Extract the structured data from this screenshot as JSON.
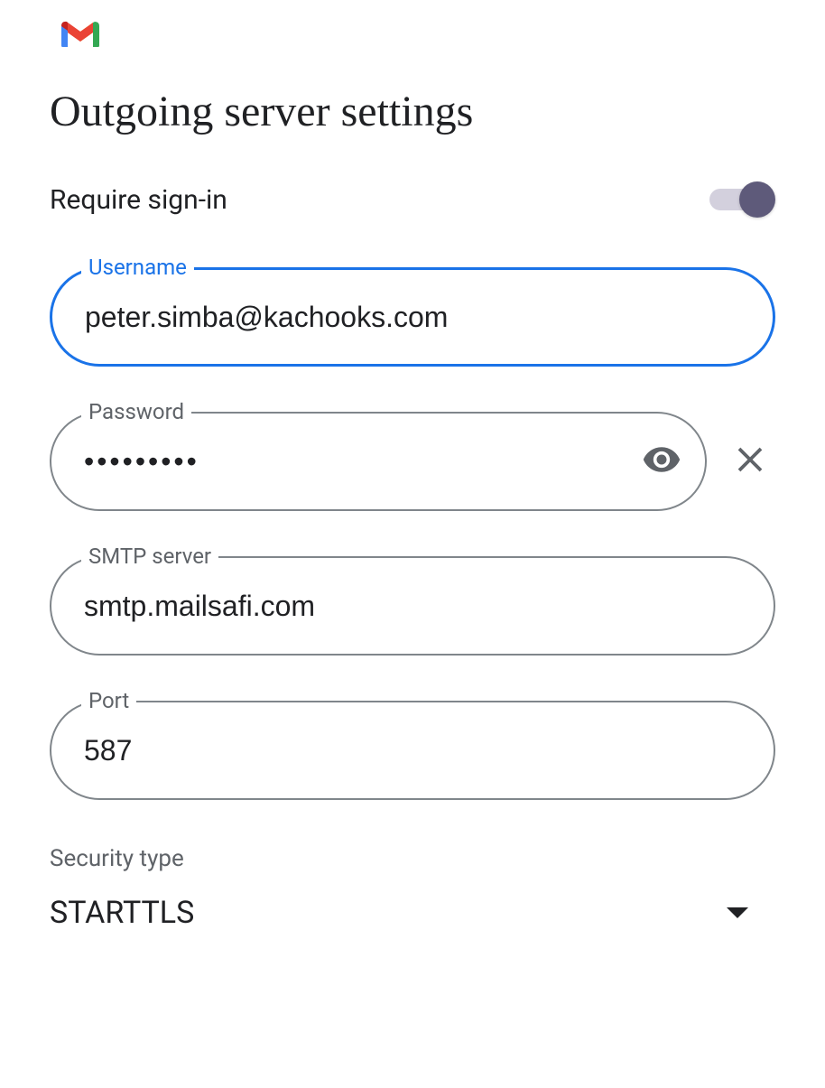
{
  "logo": "gmail",
  "title": "Outgoing server settings",
  "toggle": {
    "label": "Require sign-in",
    "state": "on"
  },
  "fields": {
    "username": {
      "label": "Username",
      "value": "peter.simba@kachooks.com"
    },
    "password": {
      "label": "Password",
      "value": "•••••••••"
    },
    "smtp": {
      "label": "SMTP server",
      "value": "smtp.mailsafi.com"
    },
    "port": {
      "label": "Port",
      "value": "587"
    }
  },
  "security": {
    "label": "Security type",
    "value": "STARTTLS"
  },
  "icons": {
    "eye": "visibility-icon",
    "close": "close-icon",
    "dropdown": "dropdown-icon"
  }
}
